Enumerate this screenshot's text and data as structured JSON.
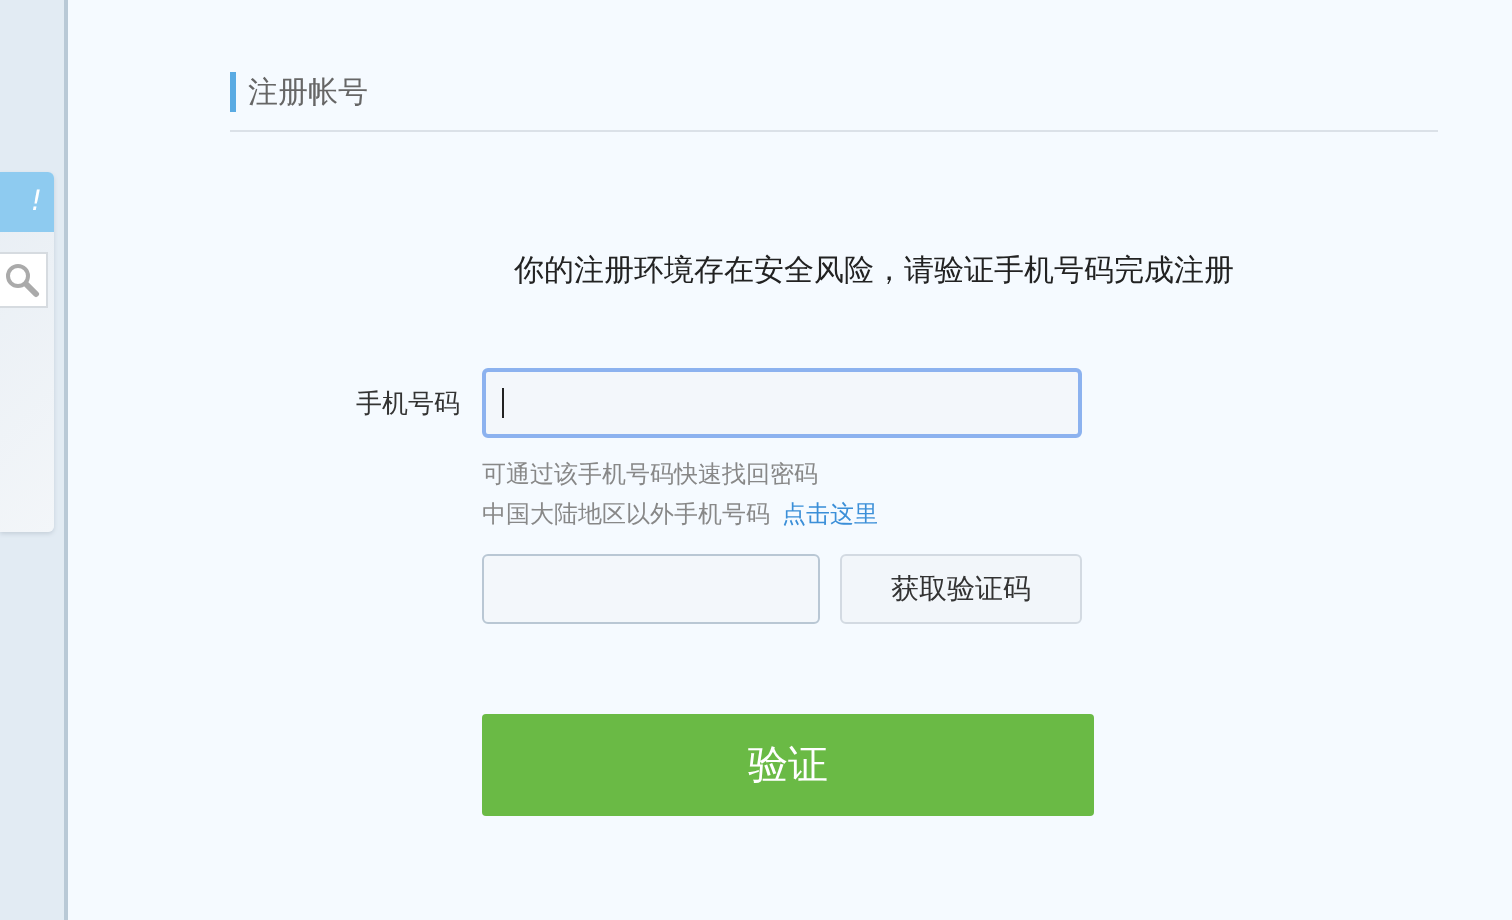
{
  "sidebar_card": {
    "header": "!"
  },
  "section_title": "注册帐号",
  "notice": "你的注册环境存在安全风险，请验证手机号码完成注册",
  "phone_field": {
    "label": "手机号码",
    "focused": true
  },
  "hints": [
    {
      "text": "可通过该手机号码快速找回密码"
    },
    {
      "text": "中国大陆地区以外手机号码",
      "link": "点击这里"
    }
  ],
  "code_field": {
    "button": "获取验证码"
  },
  "submit_button": "验证"
}
